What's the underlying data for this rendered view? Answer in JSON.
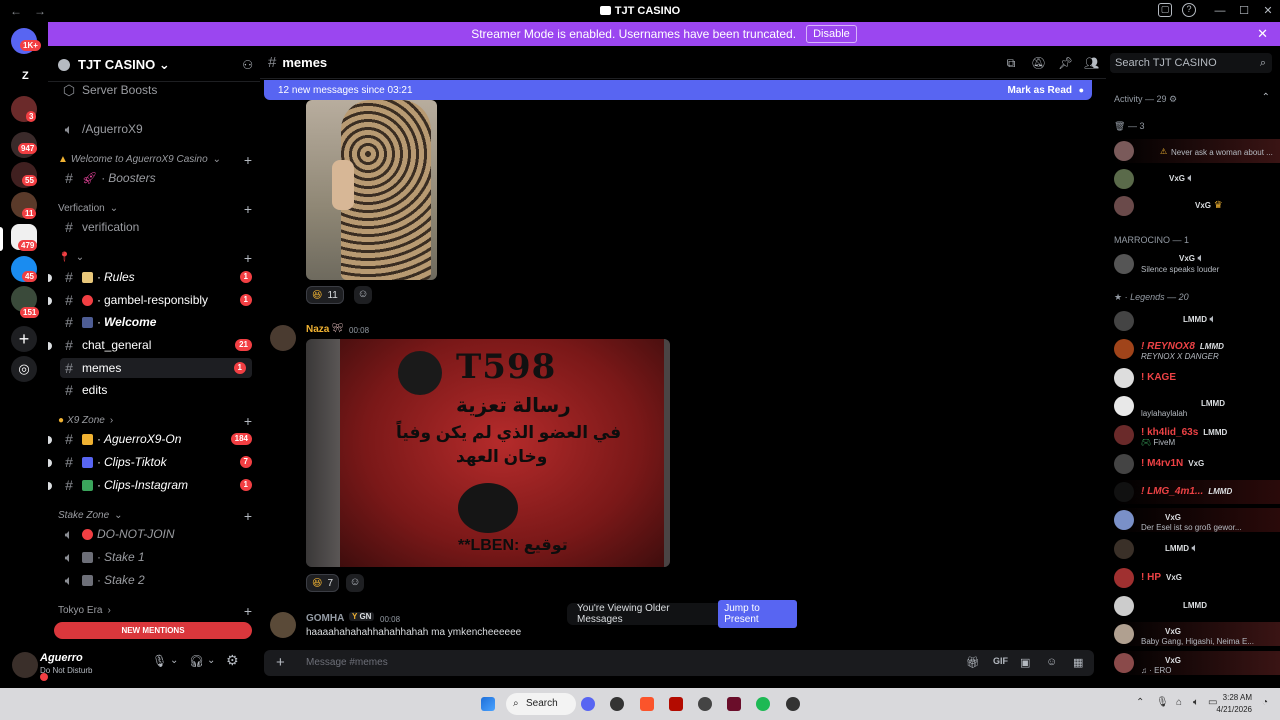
{
  "window": {
    "title": "TJT CASINO",
    "back": "←",
    "forward": "→"
  },
  "rail": {
    "badges": [
      "1K+",
      "3",
      "947",
      "55",
      "11",
      "479",
      "45",
      "151"
    ]
  },
  "banner": {
    "text": "Streamer Mode is enabled. Usernames have been truncated.",
    "disable": "Disable"
  },
  "server": {
    "name": "TJT CASINO ⌄"
  },
  "sidebar": {
    "boosts": "Server Boosts",
    "voice_top": "/AguerroX9",
    "cat_welcome": "Welcome to AguerroX9 Casino",
    "boosters": "Boosters",
    "cat_verification": "Verfication",
    "verification": "verification",
    "ch_rules": "Rules",
    "ch_gambel": "gambel-responsibly",
    "ch_welcome": "Welcome",
    "ch_general": "chat_general",
    "ch_memes": "memes",
    "ch_edits": "edits",
    "cat_x9": "X9 Zone",
    "ch_aguerro_on": "AguerroX9-On",
    "ch_clips_tiktok": "Clips-Tiktok",
    "ch_clips_insta": "Clips-Instagram",
    "cat_stake": "Stake Zone",
    "ch_donotjoin": "DO-NOT-JOIN",
    "ch_stake1": "Stake 1",
    "ch_stake2": "Stake 2",
    "cat_tokyo": "Tokyo Era",
    "badges": {
      "rules": "1",
      "gambel": "1",
      "general": "21",
      "memes": "1",
      "aguerro_on": "184",
      "tiktok": "7",
      "insta": "1"
    },
    "new_mentions": "NEW MENTIONS"
  },
  "user": {
    "name": "Aguerro",
    "status": "Do Not Disturb"
  },
  "chat": {
    "channel": "memes",
    "new_messages": "12 new messages since 03:21",
    "mark_read": "Mark as Read",
    "reactions": {
      "first": "11",
      "second": "7"
    },
    "msg1": {
      "author": "Naza",
      "time": "00:08"
    },
    "img2": {
      "title": "T598",
      "line1": "رسالة تعزية",
      "line2": "في العضو الذي لم يكن وفياً",
      "line3": "وخان العهد",
      "sign": "**LBEN: توقيع"
    },
    "msg2": {
      "author": "GOMHA",
      "tag": "GN",
      "time": "00:08",
      "text": "haaaahahahahhahahhahah ma ymkencheeeeee"
    },
    "older": "You're Viewing Older Messages",
    "jump": "Jump to Present",
    "placeholder": "Message #memes"
  },
  "search": {
    "placeholder": "Search TJT CASINO"
  },
  "members": {
    "activity": "Activity — 29",
    "g1": "— 3",
    "m1_sub": "Never ask a woman about ...",
    "m2_tag": "VxG",
    "m3_tag": "VxG",
    "marrocino": "MARROCINO — 1",
    "m4_tag": "VxG",
    "m4_sub": "Silence speaks louder",
    "legends": "Legends — 20",
    "l1_tag": "LMMD",
    "l2_name": "! REYNOX8",
    "l2_tag": "LMMD",
    "l2_sub": "REYNOX X DANGER",
    "l3_name": "! KAGE",
    "l4_tag": "LMMD",
    "l4_sub": "laylahaylalah",
    "l5_name": "! kh4lid_63s",
    "l5_tag": "LMMD",
    "l5_sub": "FiveM",
    "l6_name": "! M4rv1N",
    "l6_tag": "VxG",
    "l7_name": "! LMG_4m1...",
    "l7_tag": "LMMD",
    "l8_tag": "VxG",
    "l8_sub": "Der Esel ist so groß gewor...",
    "l9_tag": "LMMD",
    "l10_name": "! HP",
    "l10_tag": "VxG",
    "l11_tag": "LMMD",
    "l12_tag": "VxG",
    "l12_sub": "Baby Gang, Higashi, Neima E...",
    "l13_tag": "VxG",
    "l13_sub": "ERO"
  },
  "taskbar": {
    "search": "Search",
    "time": "3:28 AM",
    "date": "4/21/2026"
  },
  "colors": {
    "accent": "#5865f2",
    "banner": "#9b46f0",
    "danger": "#f23f43",
    "gold": "#f0b232",
    "red_name": "#ed4245"
  }
}
